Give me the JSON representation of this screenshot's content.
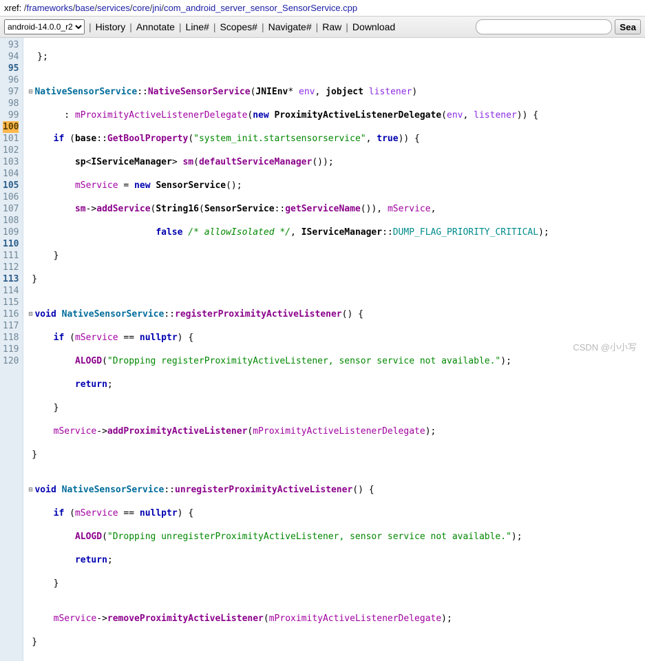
{
  "xref": {
    "label": "xref: ",
    "parts": [
      "",
      "frameworks",
      "base",
      "services",
      "core",
      "jni",
      "com_android_server_sensor_SensorService.cpp"
    ]
  },
  "toolbar": {
    "branch": "android-14.0.0_r2",
    "history": "History",
    "annotate": "Annotate",
    "line": "Line#",
    "scopes": "Scopes#",
    "navigate": "Navigate#",
    "raw": "Raw",
    "download": "Download",
    "search_btn": "Sea"
  },
  "lines": [
    {
      "n": "93"
    },
    {
      "n": "94"
    },
    {
      "n": "95",
      "bold": true
    },
    {
      "n": "96"
    },
    {
      "n": "97"
    },
    {
      "n": "98"
    },
    {
      "n": "99"
    },
    {
      "n": "100",
      "hl": true
    },
    {
      "n": "101"
    },
    {
      "n": "102"
    },
    {
      "n": "103"
    },
    {
      "n": "104"
    },
    {
      "n": "105",
      "bold": true
    },
    {
      "n": "106"
    },
    {
      "n": "107"
    },
    {
      "n": "108"
    },
    {
      "n": "109"
    },
    {
      "n": "110",
      "bold": true
    },
    {
      "n": "111"
    },
    {
      "n": "112"
    },
    {
      "n": "113",
      "bold": true
    },
    {
      "n": "114"
    },
    {
      "n": "115"
    },
    {
      "n": "116"
    },
    {
      "n": "117"
    },
    {
      "n": "118"
    },
    {
      "n": "119"
    },
    {
      "n": "120"
    }
  ],
  "code": {
    "l93": "};",
    "l95_a": "NativeSensorService",
    "l95_b": "NativeSensorService",
    "l95_c": "JNIEnv",
    "l95_d": "env",
    "l95_e": "jobject",
    "l95_f": "listener",
    "l96_a": "mProximityActiveListenerDelegate",
    "l96_b": "new",
    "l96_c": "ProximityActiveListenerDelegate",
    "l96_d": "env",
    "l96_e": "listener",
    "l97_a": "if",
    "l97_b": "base",
    "l97_c": "GetBoolProperty",
    "l97_d": "\"system_init.startsensorservice\"",
    "l97_e": "true",
    "l98_a": "sp",
    "l98_b": "IServiceManager",
    "l98_c": "sm",
    "l98_d": "defaultServiceManager",
    "l99_a": "mService",
    "l99_b": "new",
    "l99_c": "SensorService",
    "l100_a": "sm",
    "l100_b": "addService",
    "l100_c": "String16",
    "l100_d": "SensorService",
    "l100_e": "getServiceName",
    "l100_f": "mService",
    "l101_a": "false",
    "l101_b": "/* allowIsolated */",
    "l101_c": "IServiceManager",
    "l101_d": "DUMP_FLAG_PRIORITY_CRITICAL",
    "l105_a": "void",
    "l105_b": "NativeSensorService",
    "l105_c": "registerProximityActiveListener",
    "l106_a": "if",
    "l106_b": "mService",
    "l106_c": "nullptr",
    "l107_a": "ALOGD",
    "l107_b": "\"Dropping registerProximityActiveListener, sensor service not available.\"",
    "l108_a": "return",
    "l110_a": "mService",
    "l110_b": "addProximityActiveListener",
    "l110_c": "mProximityActiveListenerDelegate",
    "l113_a": "void",
    "l113_b": "NativeSensorService",
    "l113_c": "unregisterProximityActiveListener",
    "l114_a": "if",
    "l114_b": "mService",
    "l114_c": "nullptr",
    "l115_a": "ALOGD",
    "l115_b": "\"Dropping unregisterProximityActiveListener, sensor service not available.\"",
    "l116_a": "return",
    "l119_a": "mService",
    "l119_b": "removeProximityActiveListener",
    "l119_c": "mProximityActiveListenerDelegate"
  },
  "watermark": "CSDN @小小写"
}
